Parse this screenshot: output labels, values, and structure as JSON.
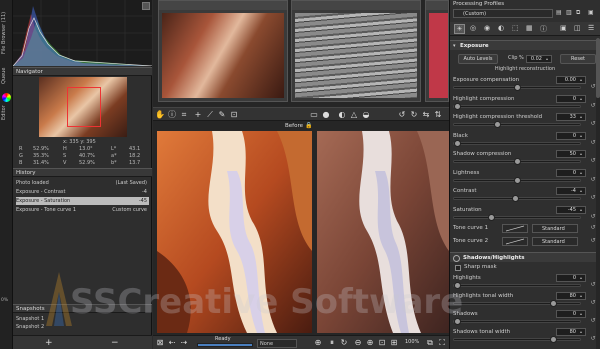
{
  "left_strip": {
    "tabs": [
      "File Browser (11)",
      "Queue",
      "Editor"
    ]
  },
  "navigator": {
    "title": "Navigator",
    "coords": "x: 335  y: 395",
    "rows": [
      {
        "a": "R",
        "av": "52.9%",
        "b": "H",
        "bv": "13.0°",
        "c": "L*",
        "cv": "43.1"
      },
      {
        "a": "G",
        "av": "35.3%",
        "b": "S",
        "bv": "40.7%",
        "c": "a*",
        "cv": "18.2"
      },
      {
        "a": "B",
        "av": "31.4%",
        "b": "V",
        "bv": "52.9%",
        "c": "b*",
        "cv": "13.7"
      }
    ]
  },
  "history": {
    "title": "History",
    "items": [
      {
        "label": "Photo loaded",
        "value": "(Last Saved)"
      },
      {
        "label": "Exposure - Contrast",
        "value": "-4"
      },
      {
        "label": "Exposure - Saturation",
        "value": "-45"
      },
      {
        "label": "Exposure - Tone curve 1",
        "value": "Custom curve"
      }
    ]
  },
  "snapshots": {
    "title": "Snapshots",
    "items": [
      "Snapshot 1",
      "Snapshot 2"
    ],
    "add": "+",
    "remove": "−"
  },
  "center": {
    "before_label": "Before",
    "status": "Ready",
    "zoom": "100%",
    "bottom_select": "None"
  },
  "right": {
    "profiles_title": "Processing Profiles",
    "profile_value": "(Custom)",
    "exposure_title": "Exposure",
    "auto_levels": "Auto Levels",
    "clip_label": "Clip %",
    "clip_value": "0.02",
    "reset": "Reset",
    "hl_recon": "Highlight reconstruction",
    "sliders": [
      {
        "label": "Exposure compensation",
        "value": "0.00"
      },
      {
        "label": "Highlight compression",
        "value": "0"
      },
      {
        "label": "Highlight compression threshold",
        "value": "33"
      },
      {
        "label": "Black",
        "value": "0"
      },
      {
        "label": "Shadow compression",
        "value": "50"
      },
      {
        "label": "Lightness",
        "value": "0"
      },
      {
        "label": "Contrast",
        "value": "-4"
      },
      {
        "label": "Saturation",
        "value": "-45"
      }
    ],
    "tone_curve_1": "Tone curve 1",
    "tone_curve_2": "Tone curve 2",
    "tone_mode": "Standard",
    "sh_title": "Shadows/Highlights",
    "sharp_mask": "Sharp mask",
    "sh_sliders": [
      {
        "label": "Highlights",
        "value": "0"
      },
      {
        "label": "Highlights tonal width",
        "value": "80"
      },
      {
        "label": "Shadows",
        "value": "0"
      },
      {
        "label": "Shadows tonal width",
        "value": "80"
      }
    ]
  },
  "watermark": "SSCreative Software",
  "colors": {
    "accent": "#9fc2e7",
    "selection": "#bcbcbc"
  }
}
